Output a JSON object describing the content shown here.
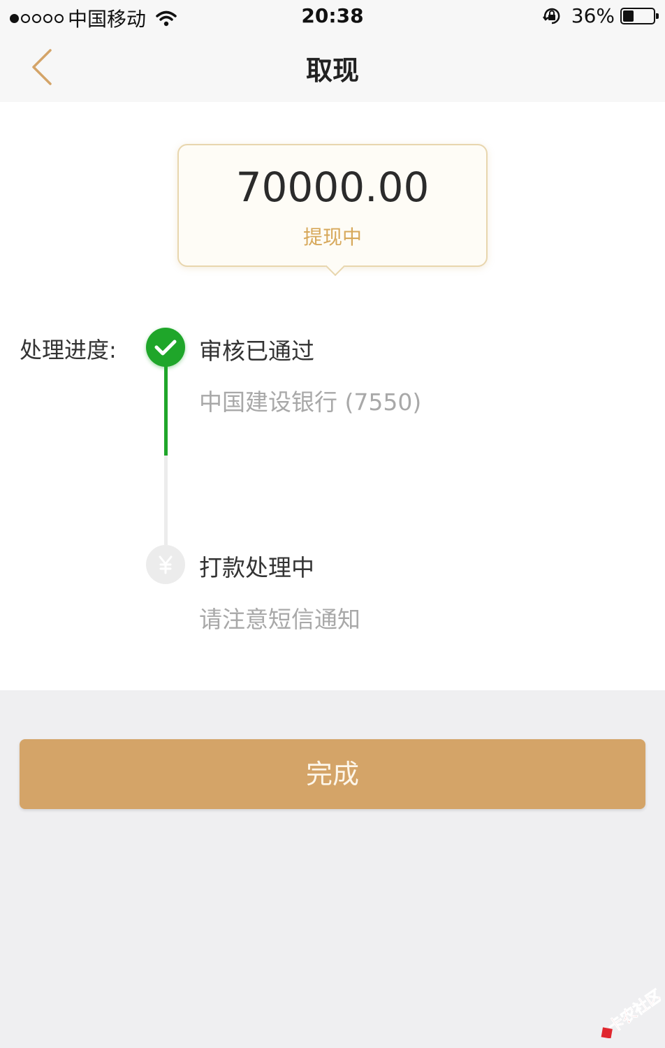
{
  "status_bar": {
    "carrier": "中国移动",
    "time": "20:38",
    "battery": "36%",
    "battery_level": 0.36,
    "signal_bars": 1
  },
  "nav": {
    "title": "取现"
  },
  "withdrawal": {
    "amount": "70000.00",
    "status": "提现中"
  },
  "progress": {
    "label": "处理进度:",
    "steps": [
      {
        "title": "审核已通过",
        "subtitle": "中国建设银行 (7550)",
        "state": "done"
      },
      {
        "title": "打款处理中",
        "subtitle": "请注意短信通知",
        "state": "pending"
      }
    ]
  },
  "actions": {
    "done_label": "完成"
  },
  "watermark": {
    "text": "卡农社区"
  },
  "colors": {
    "accent_gold": "#d4a468",
    "success_green": "#1fa62a",
    "status_gold_text": "#d7a85a"
  }
}
